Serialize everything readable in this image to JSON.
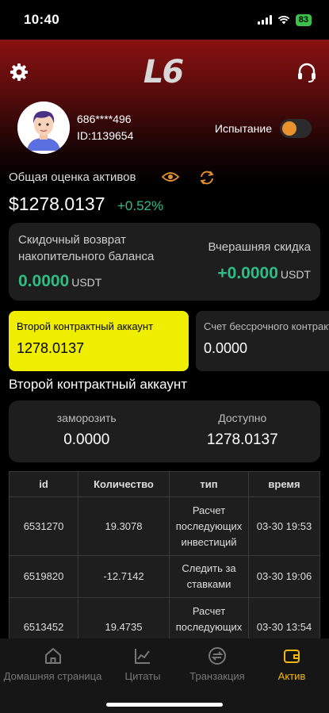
{
  "status_bar": {
    "time": "10:40",
    "battery": "83"
  },
  "header": {
    "logo_text": "L6"
  },
  "profile": {
    "username": "686****496",
    "user_id": "ID:1139654",
    "trial_label": "Испытание"
  },
  "assets": {
    "title": "Общая оценка активов",
    "value": "$1278.0137",
    "change": "+0.52%"
  },
  "rebate": {
    "left_label": "Скидочный возврат накопительного баланса",
    "left_value": "0.0000",
    "right_label": "Вчерашняя скидка",
    "right_value": "+0.0000",
    "unit": "USDT"
  },
  "accounts": [
    {
      "name": "Второй контрактный аккаунт",
      "value": "1278.0137"
    },
    {
      "name": "Счет бессрочного контракта",
      "value": "0.0000"
    }
  ],
  "section_title": "Второй контрактный аккаунт",
  "balances": {
    "frozen_label": "заморозить",
    "frozen_value": "0.0000",
    "available_label": "Доступно",
    "available_value": "1278.0137"
  },
  "table": {
    "headers": [
      "id",
      "Количество",
      "тип",
      "время"
    ],
    "rows": [
      {
        "id": "6531270",
        "amount": "19.3078",
        "type": "Расчет последующих инвестиций",
        "time": "03-30 19:53"
      },
      {
        "id": "6519820",
        "amount": "-12.7142",
        "type": "Следить за ставками",
        "time": "03-30 19:06"
      },
      {
        "id": "6513452",
        "amount": "19.4735",
        "type": "Расчет последующих инвестиций",
        "time": "03-30 13:54"
      }
    ]
  },
  "nav": {
    "items": [
      {
        "label": "Домашняя страница",
        "icon": "home-icon"
      },
      {
        "label": "Цитаты",
        "icon": "chart-icon"
      },
      {
        "label": "Транзакция",
        "icon": "exchange-icon"
      },
      {
        "label": "Актив",
        "icon": "wallet-icon"
      }
    ],
    "active_color": "#f0b90b"
  },
  "colors": {
    "accent_yellow": "#f0ee00",
    "positive_green": "#2ebd85",
    "toggle_orange": "#e8922e",
    "header_red": "#8a1111"
  }
}
